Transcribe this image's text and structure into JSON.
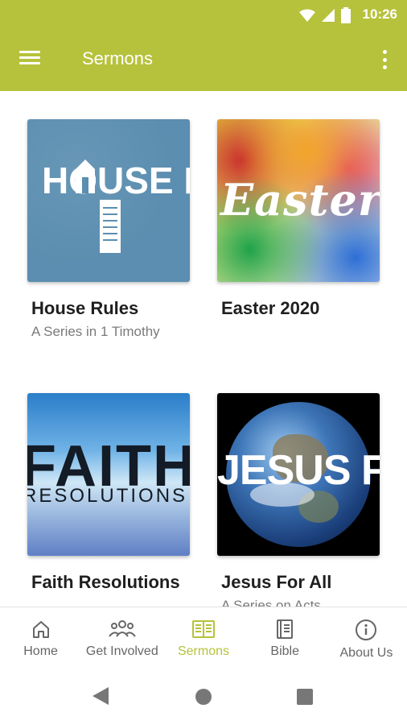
{
  "status": {
    "time": "10:26"
  },
  "appbar": {
    "title": "Sermons",
    "accent": "#b6c23b"
  },
  "sermons": [
    {
      "title": "House Rules",
      "subtitle": "A Series in 1 Timothy",
      "art": "HOUSE RULES"
    },
    {
      "title": "Easter 2020",
      "subtitle": "",
      "art": "Easter"
    },
    {
      "title": "Faith Resolutions",
      "subtitle": "",
      "art": "FAITH",
      "art_sub": "RESOLUTIONS"
    },
    {
      "title": "Jesus For All",
      "subtitle": "A Series on Acts",
      "art": "JESUS FOR ALL"
    }
  ],
  "bottom_nav": [
    {
      "label": "Home",
      "icon": "home-icon"
    },
    {
      "label": "Get Involved",
      "icon": "people-icon"
    },
    {
      "label": "Sermons",
      "icon": "book-open-icon",
      "active": true
    },
    {
      "label": "Bible",
      "icon": "bible-icon"
    },
    {
      "label": "About Us",
      "icon": "info-icon"
    }
  ]
}
